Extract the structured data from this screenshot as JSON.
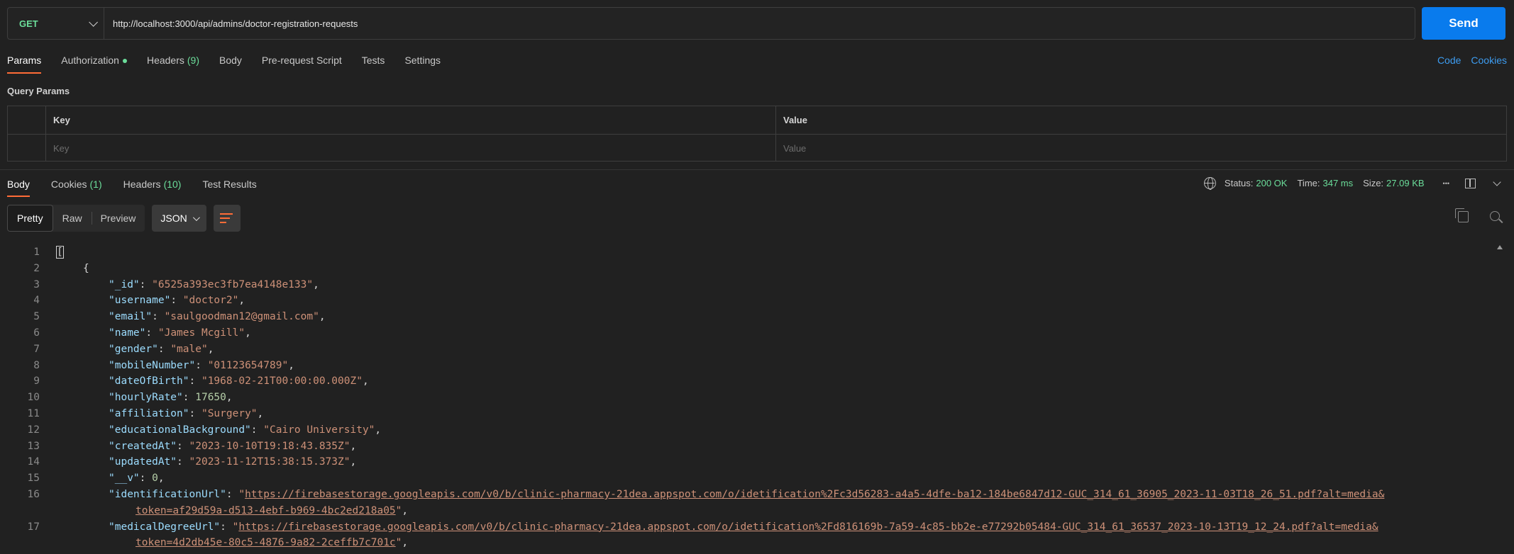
{
  "request": {
    "method": "GET",
    "url": "http://localhost:3000/api/admins/doctor-registration-requests",
    "send_label": "Send"
  },
  "request_tabs": [
    {
      "label": "Params",
      "count": "",
      "active": true
    },
    {
      "label": "Authorization",
      "count": "",
      "dot": true
    },
    {
      "label": "Headers",
      "count": "(9)"
    },
    {
      "label": "Body",
      "count": ""
    },
    {
      "label": "Pre-request Script",
      "count": ""
    },
    {
      "label": "Tests",
      "count": ""
    },
    {
      "label": "Settings",
      "count": ""
    }
  ],
  "right_links": {
    "code": "Code",
    "cookies": "Cookies"
  },
  "query_params": {
    "title": "Query Params",
    "key_header": "Key",
    "value_header": "Value",
    "key_placeholder": "Key",
    "value_placeholder": "Value"
  },
  "response_tabs": [
    {
      "label": "Body",
      "count": "",
      "active": true
    },
    {
      "label": "Cookies",
      "count": "(1)"
    },
    {
      "label": "Headers",
      "count": "(10)"
    },
    {
      "label": "Test Results",
      "count": ""
    }
  ],
  "status": {
    "status_label": "Status:",
    "status_value": "200 OK",
    "time_label": "Time:",
    "time_value": "347 ms",
    "size_label": "Size:",
    "size_value": "27.09 KB",
    "more": "•••"
  },
  "view_modes": {
    "pretty": "Pretty",
    "raw": "Raw",
    "preview": "Preview"
  },
  "format": "JSON",
  "code_lines": [
    {
      "n": "1",
      "indent": 0,
      "parts": [
        {
          "t": "[",
          "c": "p cursor"
        }
      ]
    },
    {
      "n": "2",
      "indent": 1,
      "parts": [
        {
          "t": "{",
          "c": "p"
        }
      ]
    },
    {
      "n": "3",
      "indent": 2,
      "parts": [
        {
          "t": "\"_id\"",
          "c": "k"
        },
        {
          "t": ": ",
          "c": "p"
        },
        {
          "t": "\"6525a393ec3fb7ea4148e133\"",
          "c": "s"
        },
        {
          "t": ",",
          "c": "p"
        }
      ]
    },
    {
      "n": "4",
      "indent": 2,
      "parts": [
        {
          "t": "\"username\"",
          "c": "k"
        },
        {
          "t": ": ",
          "c": "p"
        },
        {
          "t": "\"doctor2\"",
          "c": "s"
        },
        {
          "t": ",",
          "c": "p"
        }
      ]
    },
    {
      "n": "5",
      "indent": 2,
      "parts": [
        {
          "t": "\"email\"",
          "c": "k"
        },
        {
          "t": ": ",
          "c": "p"
        },
        {
          "t": "\"saulgoodman12@gmail.com\"",
          "c": "s"
        },
        {
          "t": ",",
          "c": "p"
        }
      ]
    },
    {
      "n": "6",
      "indent": 2,
      "parts": [
        {
          "t": "\"name\"",
          "c": "k"
        },
        {
          "t": ": ",
          "c": "p"
        },
        {
          "t": "\"James Mcgill\"",
          "c": "s"
        },
        {
          "t": ",",
          "c": "p"
        }
      ]
    },
    {
      "n": "7",
      "indent": 2,
      "parts": [
        {
          "t": "\"gender\"",
          "c": "k"
        },
        {
          "t": ": ",
          "c": "p"
        },
        {
          "t": "\"male\"",
          "c": "s"
        },
        {
          "t": ",",
          "c": "p"
        }
      ]
    },
    {
      "n": "8",
      "indent": 2,
      "parts": [
        {
          "t": "\"mobileNumber\"",
          "c": "k"
        },
        {
          "t": ": ",
          "c": "p"
        },
        {
          "t": "\"01123654789\"",
          "c": "s"
        },
        {
          "t": ",",
          "c": "p"
        }
      ]
    },
    {
      "n": "9",
      "indent": 2,
      "parts": [
        {
          "t": "\"dateOfBirth\"",
          "c": "k"
        },
        {
          "t": ": ",
          "c": "p"
        },
        {
          "t": "\"1968-02-21T00:00:00.000Z\"",
          "c": "s"
        },
        {
          "t": ",",
          "c": "p"
        }
      ]
    },
    {
      "n": "10",
      "indent": 2,
      "parts": [
        {
          "t": "\"hourlyRate\"",
          "c": "k"
        },
        {
          "t": ": ",
          "c": "p"
        },
        {
          "t": "17650",
          "c": "n"
        },
        {
          "t": ",",
          "c": "p"
        }
      ]
    },
    {
      "n": "11",
      "indent": 2,
      "parts": [
        {
          "t": "\"affiliation\"",
          "c": "k"
        },
        {
          "t": ": ",
          "c": "p"
        },
        {
          "t": "\"Surgery\"",
          "c": "s"
        },
        {
          "t": ",",
          "c": "p"
        }
      ]
    },
    {
      "n": "12",
      "indent": 2,
      "parts": [
        {
          "t": "\"educationalBackground\"",
          "c": "k"
        },
        {
          "t": ": ",
          "c": "p"
        },
        {
          "t": "\"Cairo University\"",
          "c": "s"
        },
        {
          "t": ",",
          "c": "p"
        }
      ]
    },
    {
      "n": "13",
      "indent": 2,
      "parts": [
        {
          "t": "\"createdAt\"",
          "c": "k"
        },
        {
          "t": ": ",
          "c": "p"
        },
        {
          "t": "\"2023-10-10T19:18:43.835Z\"",
          "c": "s"
        },
        {
          "t": ",",
          "c": "p"
        }
      ]
    },
    {
      "n": "14",
      "indent": 2,
      "parts": [
        {
          "t": "\"updatedAt\"",
          "c": "k"
        },
        {
          "t": ": ",
          "c": "p"
        },
        {
          "t": "\"2023-11-12T15:38:15.373Z\"",
          "c": "s"
        },
        {
          "t": ",",
          "c": "p"
        }
      ]
    },
    {
      "n": "15",
      "indent": 2,
      "parts": [
        {
          "t": "\"__v\"",
          "c": "k"
        },
        {
          "t": ": ",
          "c": "p"
        },
        {
          "t": "0",
          "c": "n"
        },
        {
          "t": ",",
          "c": "p"
        }
      ]
    },
    {
      "n": "16",
      "indent": 2,
      "parts": [
        {
          "t": "\"identificationUrl\"",
          "c": "k"
        },
        {
          "t": ": ",
          "c": "p"
        },
        {
          "t": "\"",
          "c": "s"
        },
        {
          "t": "https://firebasestorage.googleapis.com/v0/b/clinic-pharmacy-21dea.appspot.com/o/idetification%2Fc3d56283-a4a5-4dfe-ba12-184be6847d12-GUC_314_61_36905_2023-11-03T18_26_51.pdf?alt=media&",
          "c": "u"
        }
      ]
    },
    {
      "n": "",
      "indent": 3,
      "parts": [
        {
          "t": "token=af29d59a-d513-4ebf-b969-4bc2ed218a05",
          "c": "u"
        },
        {
          "t": "\"",
          "c": "s"
        },
        {
          "t": ",",
          "c": "p"
        }
      ]
    },
    {
      "n": "17",
      "indent": 2,
      "parts": [
        {
          "t": "\"medicalDegreeUrl\"",
          "c": "k"
        },
        {
          "t": ": ",
          "c": "p"
        },
        {
          "t": "\"",
          "c": "s"
        },
        {
          "t": "https://firebasestorage.googleapis.com/v0/b/clinic-pharmacy-21dea.appspot.com/o/idetification%2Fd816169b-7a59-4c85-bb2e-e77292b05484-GUC_314_61_36537_2023-10-13T19_12_24.pdf?alt=media&",
          "c": "u"
        }
      ]
    },
    {
      "n": "",
      "indent": 3,
      "parts": [
        {
          "t": "token=4d2db45e-80c5-4876-9a82-2ceffb7c701c",
          "c": "u"
        },
        {
          "t": "\"",
          "c": "s"
        },
        {
          "t": ",",
          "c": "p"
        }
      ]
    }
  ]
}
